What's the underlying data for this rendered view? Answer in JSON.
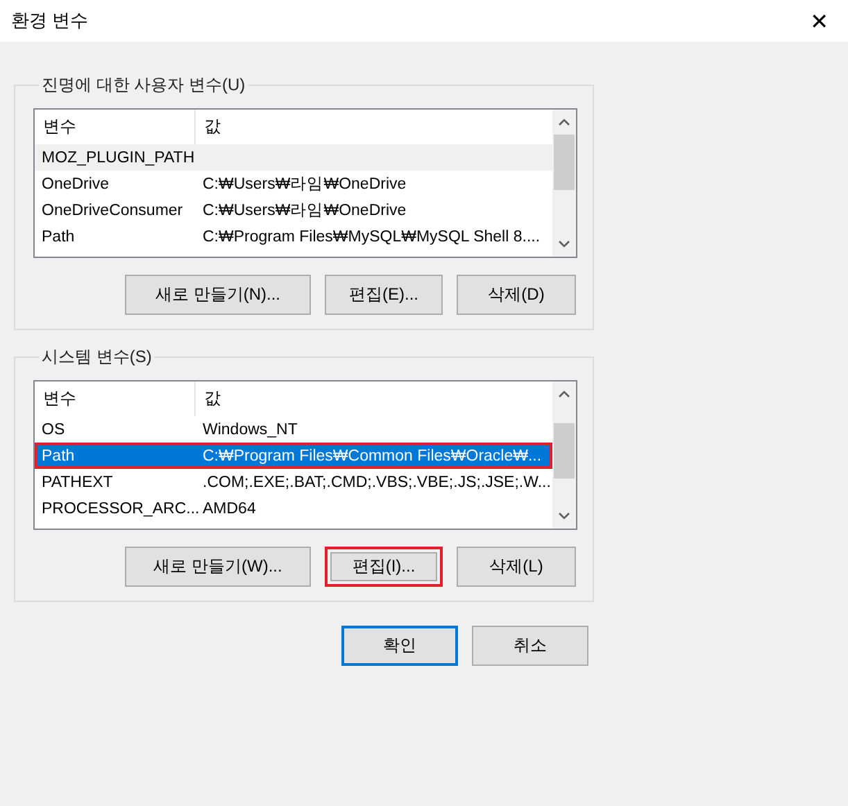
{
  "window": {
    "title": "환경 변수",
    "close": "✕"
  },
  "groups": [
    {
      "title": "진명에 대한 사용자 변수(U)",
      "columns": [
        "변수",
        "값"
      ],
      "rows": [
        {
          "name": "MOZ_PLUGIN_PATH",
          "value": "",
          "selected": false,
          "hovered": true,
          "annotated": false
        },
        {
          "name": "OneDrive",
          "value": "C:₩Users₩라임₩OneDrive",
          "selected": false,
          "hovered": false,
          "annotated": false
        },
        {
          "name": "OneDriveConsumer",
          "value": "C:₩Users₩라임₩OneDrive",
          "selected": false,
          "hovered": false,
          "annotated": false
        },
        {
          "name": "Path",
          "value": "C:₩Program Files₩MySQL₩MySQL Shell 8....",
          "selected": false,
          "hovered": false,
          "annotated": false
        }
      ],
      "buttons": [
        {
          "label": "새로 만들기(N)...",
          "annotated": false
        },
        {
          "label": "편집(E)...",
          "annotated": false
        },
        {
          "label": "삭제(D)",
          "annotated": false
        }
      ]
    },
    {
      "title": "시스템 변수(S)",
      "columns": [
        "변수",
        "값"
      ],
      "rows": [
        {
          "name": "OS",
          "value": "Windows_NT",
          "selected": false,
          "hovered": false,
          "annotated": false
        },
        {
          "name": "Path",
          "value": "C:₩Program Files₩Common Files₩Oracle₩...",
          "selected": true,
          "hovered": false,
          "annotated": true
        },
        {
          "name": "PATHEXT",
          "value": ".COM;.EXE;.BAT;.CMD;.VBS;.VBE;.JS;.JSE;.W...",
          "selected": false,
          "hovered": false,
          "annotated": false
        },
        {
          "name": "PROCESSOR_ARC...",
          "value": "AMD64",
          "selected": false,
          "hovered": false,
          "annotated": false
        }
      ],
      "buttons": [
        {
          "label": "새로 만들기(W)...",
          "annotated": false
        },
        {
          "label": "편집(I)...",
          "annotated": true
        },
        {
          "label": "삭제(L)",
          "annotated": false
        }
      ]
    }
  ],
  "footer": [
    {
      "label": "확인",
      "default": true
    },
    {
      "label": "취소",
      "default": false
    }
  ]
}
